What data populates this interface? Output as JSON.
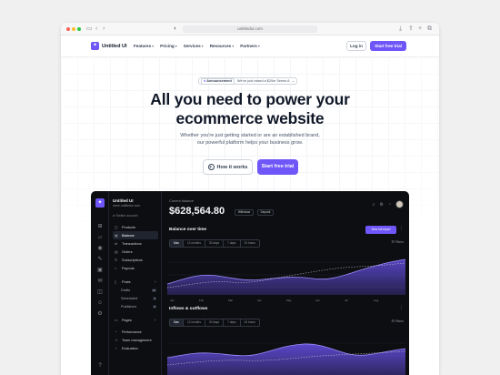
{
  "browser": {
    "url": "untitledui.com",
    "back_icon": "chevron-left-icon",
    "forward_icon": "chevron-right-icon",
    "sidebar_icon": "sidebar-icon",
    "shield_icon": "shield-icon",
    "actions": [
      "share-icon",
      "plus-icon",
      "tabs-icon",
      "download-icon"
    ]
  },
  "site": {
    "logo": "Untitled UI",
    "nav": [
      "Features",
      "Pricing",
      "Services",
      "Resources",
      "Partners"
    ],
    "login": "Log in",
    "cta": "Start free trial"
  },
  "hero": {
    "announcement_tag": "Announcement",
    "announcement_text": "We've just raised a $20m Series A",
    "announcement_arrow": "→",
    "headline_line1": "All you need to power your",
    "headline_line2": "ecommerce website",
    "sub_line1": "Whether you're just getting started or are an established brand,",
    "sub_line2": "our powerful platform helps your business grow.",
    "how_label": "How it works",
    "trial_label": "Start free trial"
  },
  "dashboard": {
    "org_name": "Untitled UI",
    "org_url": "store.untitledui.com",
    "switch_label": "Switch account",
    "menu": [
      {
        "label": "Products",
        "icon": "box-icon",
        "active": false
      },
      {
        "label": "Balance",
        "icon": "wallet-icon",
        "active": true
      },
      {
        "label": "Transactions",
        "icon": "transfer-icon",
        "active": false
      },
      {
        "label": "Orders",
        "icon": "receipt-icon",
        "active": false
      },
      {
        "label": "Subscriptions",
        "icon": "refresh-icon",
        "active": false
      },
      {
        "label": "Payouts",
        "icon": "bank-icon",
        "active": false
      }
    ],
    "posts_label": "Posts",
    "posts_sub": [
      {
        "label": "Drafts",
        "count": "10"
      },
      {
        "label": "Scheduled",
        "count": "3"
      },
      {
        "label": "Published",
        "count": "8"
      }
    ],
    "pages_label": "Pages",
    "bottom_menu": [
      "Performance",
      "Team management",
      "Evaluation"
    ],
    "balance_label": "Current balance",
    "balance_value": "$628,564.80",
    "withdraw_label": "Withdraw",
    "deposit_label": "Deposit",
    "balance_over_time": "Balance over time",
    "view_report": "View full report",
    "inflows_outflows": "Inflows & outflows",
    "tabs": [
      "Max",
      "12 months",
      "30 days",
      "7 days",
      "24 hours"
    ],
    "filters_label": "Filters",
    "more_glyph": "⋮",
    "x_labels": [
      "Jan",
      "Feb",
      "Mar",
      "Apr",
      "May",
      "Jun",
      "Jul",
      "Aug",
      "Sep",
      "Oct",
      "Nov",
      "Dec"
    ],
    "accent_color": "#6e56f8"
  }
}
